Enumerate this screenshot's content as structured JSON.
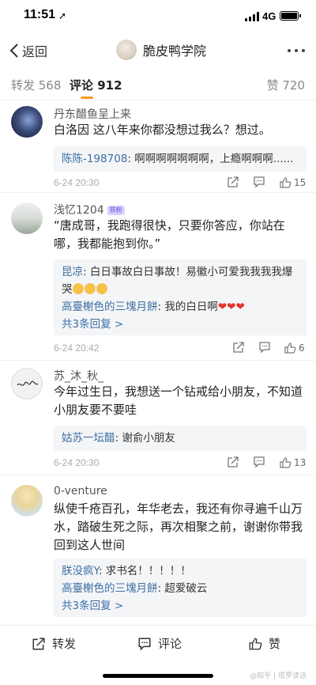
{
  "status": {
    "time": "11:51",
    "network": "4G"
  },
  "nav": {
    "back_label": "返回",
    "title": "脆皮鸭学院"
  },
  "tabs": {
    "repost": "转发 568",
    "comment": "评论 912",
    "like": "赞 720"
  },
  "comments": [
    {
      "name": "丹东醋鱼呈上来",
      "text": "白洛因 这八年来你都没想过我么？想过。",
      "replies": [
        {
          "name": "陈陈-198708",
          "text": ": 啊啊啊啊啊啊啊，上瘾啊啊啊......"
        }
      ],
      "date": "6-24 20:30",
      "likes": "15"
    },
    {
      "name": "浅忆1204",
      "badge": "铁粉",
      "text": "“唐成哥，我跑得很快，只要你答应，你站在哪，我都能抱到你。”",
      "replies": [
        {
          "name": "昆凉",
          "text": ": 白日事故白日事故！易徽小可爱我我我我爆哭"
        },
        {
          "name": "高臺榭色的三塊月餅",
          "text": ": 我的白日啊"
        }
      ],
      "more": "共3条回复 >",
      "date": "6-24 20:42",
      "likes": "6"
    },
    {
      "name": "苏_沐_秋_",
      "text": "今年过生日，我想送一个钻戒给小朋友，不知道小朋友要不要哇",
      "replies": [
        {
          "name": "姑苏一坛醋",
          "text": ": 谢俞小朋友"
        }
      ],
      "date": "6-24 20:30",
      "likes": "13"
    },
    {
      "name": "0-venture",
      "text": "纵使千疮百孔，年华老去，我还有你寻遍千山万水，踏破生死之际，再次相聚之前，谢谢你带我回到这人世间",
      "replies": [
        {
          "name": "朕没疯Y",
          "text": ": 求书名！！！！！"
        },
        {
          "name": "高臺榭色的三塊月餅",
          "text": ": 超爱破云"
        }
      ],
      "more": "共3条回复 >"
    }
  ],
  "bottom": {
    "repost": "转发",
    "comment": "评论",
    "like": "赞"
  },
  "watermark": "@知乎 | 塔罗读话",
  "icons": {
    "back": "chevron-left-icon",
    "more": "more-dots-icon",
    "share": "share-icon",
    "comment": "comment-icon",
    "like": "thumbs-up-icon",
    "heart": "heart-icon",
    "crying": "crying-emoji-icon"
  },
  "colors": {
    "accent": "#f39a1e",
    "link": "#3d6ea5",
    "heart": "#e3342f"
  }
}
